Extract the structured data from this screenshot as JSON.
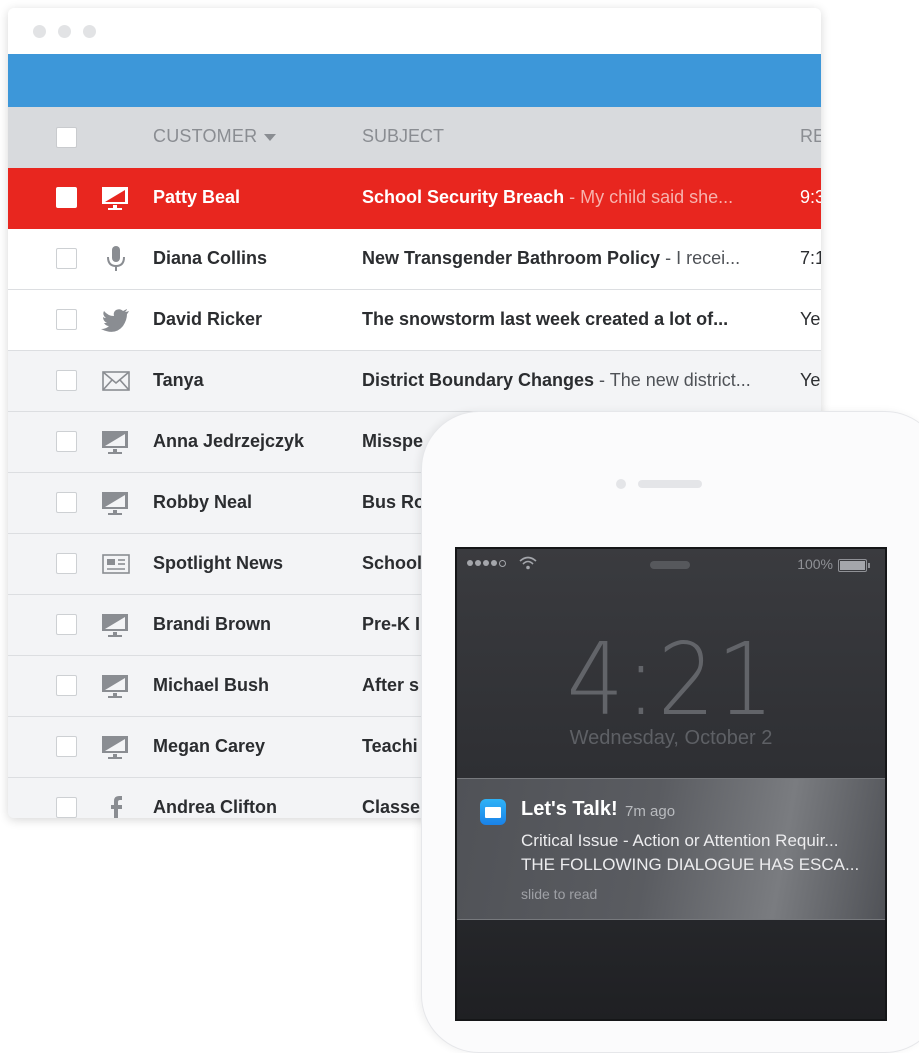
{
  "colors": {
    "accent_blue": "#3d97d9",
    "alert_red": "#e8261f",
    "header_gray": "#d8dadd"
  },
  "table": {
    "columns": {
      "customer": "CUSTOMER",
      "subject": "SUBJECT",
      "received": "RE"
    },
    "rows": [
      {
        "icon": "monitor-icon",
        "name": "Patty Beal",
        "subject": "School Security Breach",
        "preview": " - My child said she...",
        "time": "9:3",
        "highlighted": true
      },
      {
        "icon": "microphone-icon",
        "name": "Diana Collins",
        "subject": "New Transgender Bathroom Policy",
        "preview": " - I recei...",
        "time": "7:1"
      },
      {
        "icon": "twitter-icon",
        "name": "David Ricker",
        "subject": "The snowstorm last week created a lot of...",
        "preview": "",
        "time": "Ye"
      },
      {
        "icon": "envelope-icon",
        "name": "Tanya",
        "subject": "District Boundary Changes",
        "preview": " - The new district...",
        "time": "Ye"
      },
      {
        "icon": "monitor-icon",
        "name": "Anna Jedrzejczyk",
        "subject": "Misspe",
        "preview": "",
        "time": ""
      },
      {
        "icon": "monitor-icon",
        "name": "Robby Neal",
        "subject": "Bus Ro",
        "preview": "",
        "time": ""
      },
      {
        "icon": "newspaper-icon",
        "name": "Spotlight News",
        "subject": "School",
        "preview": "",
        "time": ""
      },
      {
        "icon": "monitor-icon",
        "name": "Brandi Brown",
        "subject": "Pre-K I",
        "preview": "",
        "time": ""
      },
      {
        "icon": "monitor-icon",
        "name": "Michael Bush",
        "subject": "After s",
        "preview": "",
        "time": ""
      },
      {
        "icon": "monitor-icon",
        "name": "Megan Carey",
        "subject": "Teachi",
        "preview": "",
        "time": ""
      },
      {
        "icon": "facebook-icon",
        "name": "Andrea Clifton",
        "subject": "Classe",
        "preview": "",
        "time": ""
      }
    ]
  },
  "phone": {
    "status": {
      "battery": "100%"
    },
    "time": "4:21",
    "date": "Wednesday, October 2",
    "notification": {
      "app": "Let's Talk!",
      "time_ago": "7m ago",
      "line1": "Critical Issue - Action or Attention Requir...",
      "line2": "THE FOLLOWING DIALOGUE HAS ESCA...",
      "hint": "slide to read"
    }
  }
}
